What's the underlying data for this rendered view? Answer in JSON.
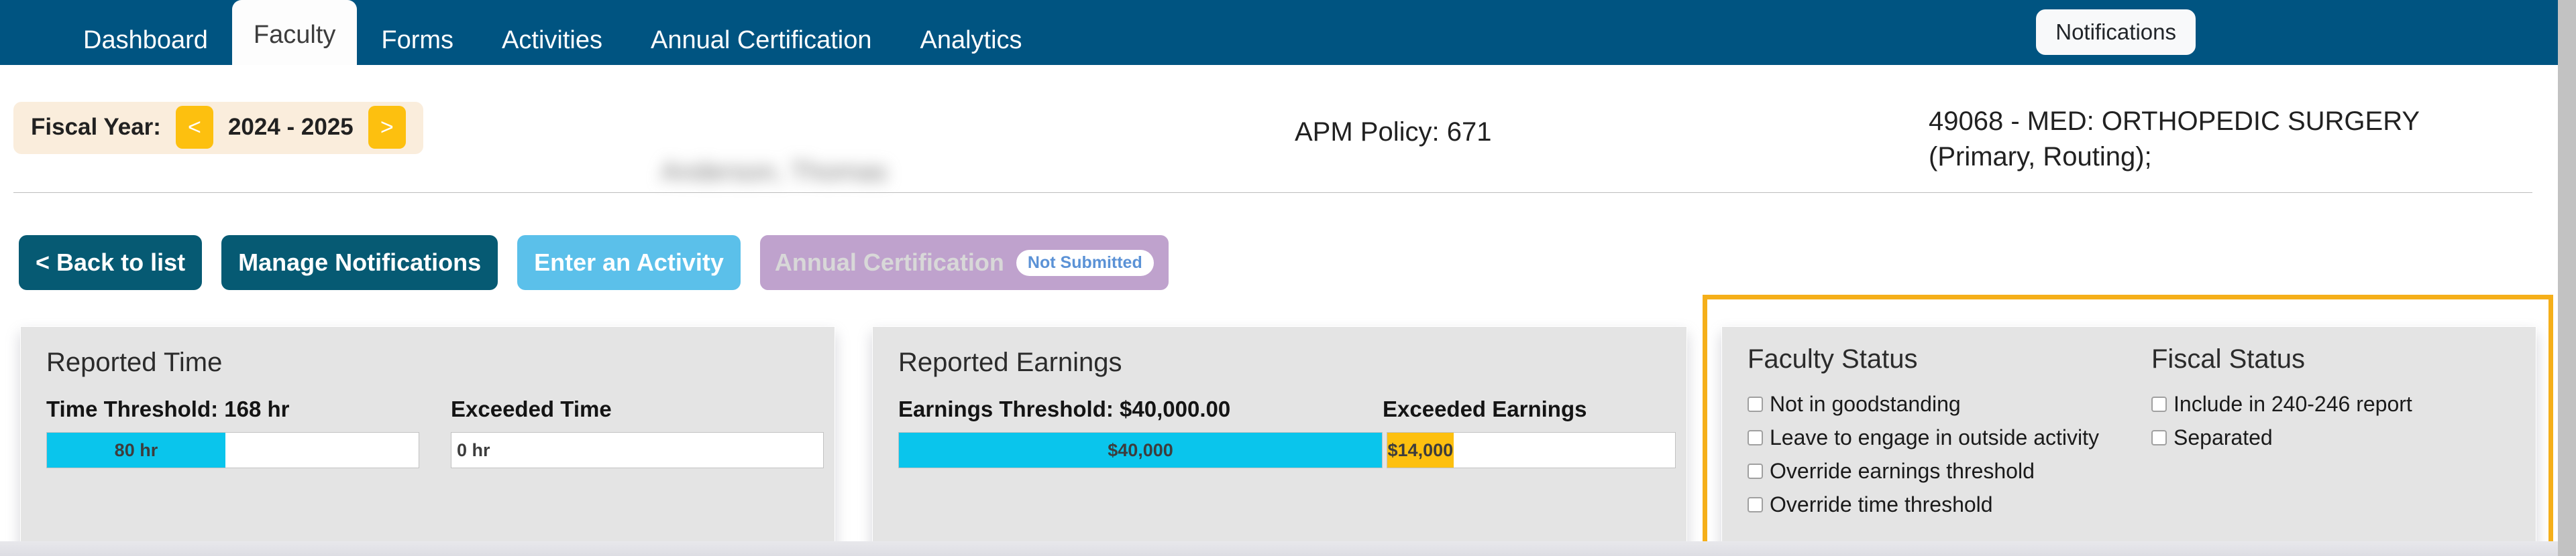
{
  "navbar": {
    "tabs": [
      {
        "label": "Dashboard",
        "active": false
      },
      {
        "label": "Faculty",
        "active": true
      },
      {
        "label": "Forms",
        "active": false
      },
      {
        "label": "Activities",
        "active": false
      },
      {
        "label": "Annual Certification",
        "active": false
      },
      {
        "label": "Analytics",
        "active": false
      }
    ],
    "notifications_label": "Notifications",
    "background_color": "#005481"
  },
  "info": {
    "fiscal_year_label": "Fiscal Year:",
    "prev_arrow": "<",
    "next_arrow": ">",
    "fiscal_year_value": "2024 - 2025",
    "faculty_name": "Anderson, Thomas",
    "apm_policy": "APM Policy: 671",
    "department_line1": "49068 - MED: ORTHOPEDIC SURGERY",
    "department_line2": "(Primary, Routing);"
  },
  "actions": {
    "back_to_list": "< Back to list",
    "manage_notifications": "Manage Notifications",
    "enter_activity": "Enter an Activity",
    "annual_certification": "Annual Certification",
    "annual_certification_badge": "Not Submitted"
  },
  "reported_time": {
    "title": "Reported Time",
    "threshold_label": "Time Threshold: 168 hr",
    "threshold_value": 168,
    "reported_value": 80,
    "reported_display": "80 hr",
    "exceeded_label": "Exceeded Time",
    "exceeded_display": "0 hr",
    "exceeded_value": 0,
    "fill_percent": 47.6
  },
  "reported_earnings": {
    "title": "Reported Earnings",
    "threshold_label": "Earnings Threshold: $40,000.00",
    "threshold_value": 40000,
    "reported_display": "$40,000",
    "reported_value": 40000,
    "exceeded_label": "Exceeded Earnings",
    "exceeded_display": "$14,000",
    "exceeded_value": 14000,
    "fill_percent": 100,
    "exceeded_fill_percent": 35
  },
  "status_card": {
    "faculty_status_title": "Faculty Status",
    "fiscal_status_title": "Fiscal Status",
    "faculty_status_items": [
      {
        "label": "Not in goodstanding",
        "checked": false
      },
      {
        "label": "Leave to engage in outside activity",
        "checked": false
      },
      {
        "label": "Override earnings threshold",
        "checked": false
      },
      {
        "label": "Override time threshold",
        "checked": false
      }
    ],
    "fiscal_status_items": [
      {
        "label": "Include in 240-246 report",
        "checked": false
      },
      {
        "label": "Separated",
        "checked": false
      }
    ],
    "highlight_color": "#f5af19"
  },
  "colors": {
    "nav_blue": "#005481",
    "accent_cyan": "#0ac5ec",
    "accent_amber": "#fdc00f",
    "button_dark": "#065a73",
    "button_light": "#5bc0ea",
    "button_purple": "#bfa2cd",
    "card_background": "#e4e4e4"
  }
}
